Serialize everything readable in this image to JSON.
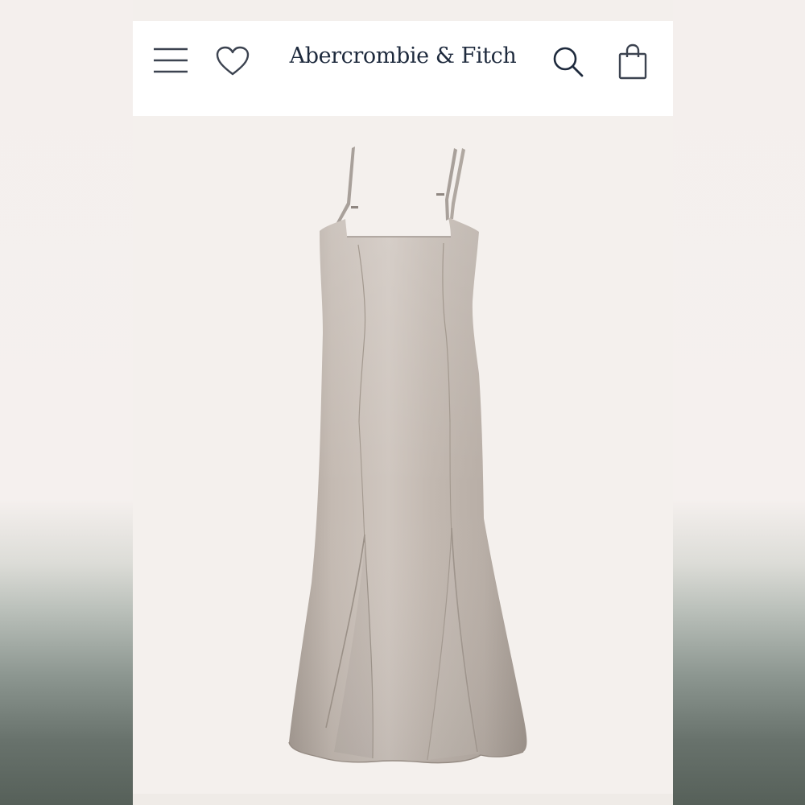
{
  "header": {
    "brand": "Abercrombie & Fitch",
    "icons": {
      "menu": "hamburger-menu-icon",
      "wishlist": "heart-icon",
      "search": "search-icon",
      "bag": "shopping-bag-icon"
    }
  },
  "product": {
    "image": "satin slip maxi dress, taupe"
  },
  "colors": {
    "brand_navy": "#1e2a3d",
    "dress_taupe": "#bdb3ab",
    "page_background": "#f4f0ed"
  }
}
